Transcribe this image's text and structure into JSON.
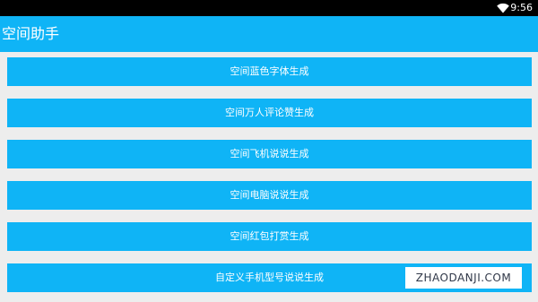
{
  "status_bar": {
    "time": "9:56",
    "wifi_icon": "wifi-icon"
  },
  "app_bar": {
    "title": "空间助手"
  },
  "buttons": [
    {
      "label": "空间蓝色字体生成"
    },
    {
      "label": "空间万人评论赞生成"
    },
    {
      "label": "空间飞机说说生成"
    },
    {
      "label": "空间电脑说说生成"
    },
    {
      "label": "空间红包打赏生成"
    },
    {
      "label": "自定义手机型号说说生成"
    }
  ],
  "watermark": {
    "text": "ZHAODANJI.COM"
  },
  "colors": {
    "accent": "#0fb4f6",
    "background": "#ededed",
    "status_bar": "#000000"
  }
}
